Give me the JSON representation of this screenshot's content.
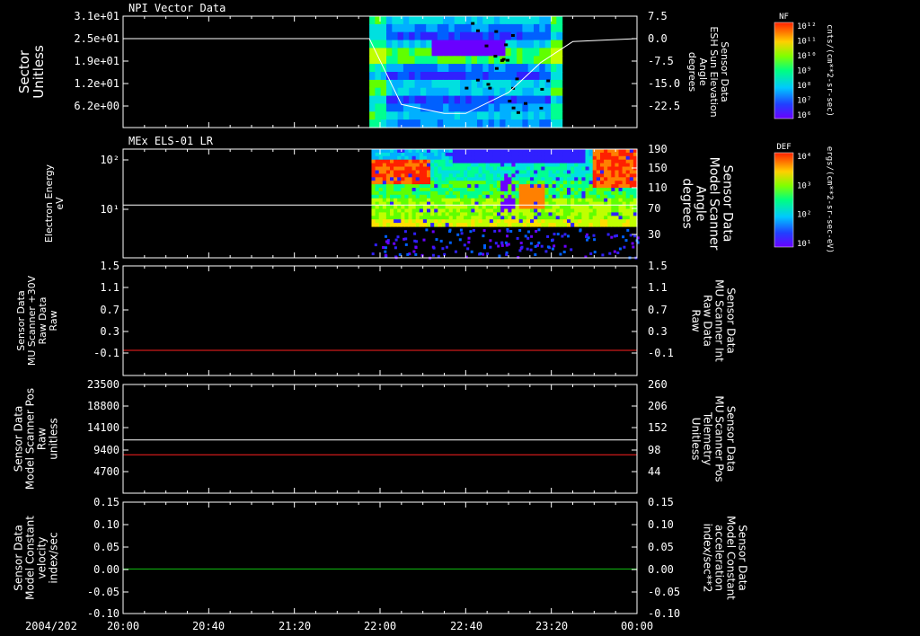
{
  "date_label": "2004/202",
  "x_ticks": [
    "20:00",
    "20:40",
    "21:20",
    "22:00",
    "22:40",
    "23:20",
    "00:00"
  ],
  "colors": {
    "red_label": "#ff2020",
    "green_label": "#10ff10",
    "trace_red": "#ff2020",
    "trace_green": "#10c010",
    "trace_white": "#ffffff"
  },
  "chart_data": [
    {
      "type": "heatmap",
      "title": "NPI Vector Data",
      "ylabel": [
        "Sector",
        "Unitless"
      ],
      "y_ticks": [
        "3.1e+01",
        "2.5e+01",
        "1.9e+01",
        "1.2e+01",
        "6.2e+00"
      ],
      "y2label": [
        "Sensor Data",
        "ESH Sun Elevation",
        "Angle",
        "degrees"
      ],
      "y2_ticks": [
        "7.5",
        "0.0",
        "-7.5",
        "-15.0",
        "-22.5"
      ],
      "colorbar_title": "NF",
      "colorbar_unit": "cnts/(cm**2-sr-sec)",
      "colorbar_ticks": [
        "10¹²",
        "10¹¹",
        "10¹⁰",
        "10⁹",
        "10⁸",
        "10⁷",
        "10⁶"
      ],
      "data_span": [
        "21:55",
        "23:25"
      ],
      "overlay": {
        "name": "ESH Sun Elevation",
        "x": [
          "20:00",
          "21:55",
          "22:10",
          "22:30",
          "22:40",
          "23:00",
          "23:15",
          "23:30",
          "00:00"
        ],
        "y": [
          0.0,
          0.0,
          -22.0,
          -25.0,
          -25.0,
          -18.0,
          -8.0,
          -1.0,
          0.0
        ]
      }
    },
    {
      "type": "heatmap",
      "title": "MEx ELS-01 LR",
      "ylabel": [
        "Electron Energy",
        "eV"
      ],
      "y_ticks": [
        "10²",
        "10¹"
      ],
      "y2label": [
        "Sensor Data",
        "Model Scanner",
        "Angle",
        "degrees"
      ],
      "y2_ticks": [
        "190",
        "150",
        "110",
        "70",
        "30"
      ],
      "colorbar_title": "DEF",
      "colorbar_unit": "ergs/(cm**2-sr-sec-eV)",
      "colorbar_ticks": [
        "10⁴",
        "10³",
        "10²",
        "10¹"
      ],
      "data_span": [
        "21:56",
        "00:00"
      ],
      "overlay": {
        "name": "Model Scanner Angle",
        "x": [
          "20:00",
          "00:00"
        ],
        "y": [
          85,
          85
        ]
      }
    },
    {
      "type": "line",
      "ylabel": [
        "Sensor Data",
        "MU Scanner +30V",
        "Raw Data",
        "Raw"
      ],
      "y_ticks": [
        "1.5",
        "1.1",
        "0.7",
        "0.3",
        "-0.1"
      ],
      "y2label": [
        "Sensor Data",
        "MU Scanner Int",
        "Raw Data",
        "Raw"
      ],
      "y2_ticks": [
        "1.5",
        "1.1",
        "0.7",
        "0.3",
        "-0.1"
      ],
      "ylim": [
        -0.4,
        1.5
      ],
      "series": [
        {
          "name": "MU Scanner Int",
          "x": [
            "20:00",
            "00:00"
          ],
          "y": [
            -0.05,
            -0.05
          ]
        }
      ]
    },
    {
      "type": "line",
      "ylabel": [
        "Sensor Data",
        "Model Scanner Pos",
        "Raw",
        "unitless"
      ],
      "y_ticks": [
        "23500",
        "18800",
        "14100",
        "9400",
        "4700"
      ],
      "y2label": [
        "Sensor Data",
        "MU Scanner Pos",
        "Telemetry",
        "Unitless"
      ],
      "y2_ticks": [
        "260",
        "206",
        "152",
        "98",
        "44"
      ],
      "ylim": [
        0,
        23500
      ],
      "ylim2": [
        0,
        260
      ],
      "series": [
        {
          "name": "Model Scanner Pos",
          "x": [
            "20:00",
            "00:00"
          ],
          "y": [
            11500,
            11500
          ]
        },
        {
          "name": "MU Scanner Pos Telemetry",
          "x": [
            "20:00",
            "00:00"
          ],
          "y2": [
            92,
            92
          ]
        }
      ]
    },
    {
      "type": "line",
      "ylabel": [
        "Sensor Data",
        "Model Constant",
        "velocity",
        "index/sec"
      ],
      "y_ticks": [
        "0.15",
        "0.10",
        "0.05",
        "0.00",
        "-0.05",
        "-0.10"
      ],
      "y2label": [
        "Sensor Data",
        "Model Constant",
        "acceleration",
        "index/sec**2"
      ],
      "y2_ticks": [
        "0.15",
        "0.10",
        "0.05",
        "0.00",
        "-0.05",
        "-0.10"
      ],
      "ylim": [
        -0.1,
        0.15
      ],
      "series": [
        {
          "name": "Model Constant acceleration",
          "x": [
            "20:00",
            "00:00"
          ],
          "y": [
            0.0,
            0.0
          ]
        }
      ]
    }
  ]
}
